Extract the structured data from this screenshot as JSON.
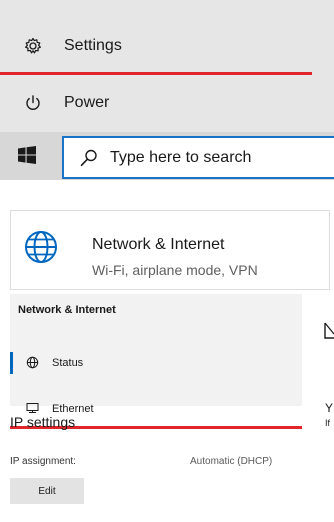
{
  "start_menu": {
    "settings_label": "Settings",
    "power_label": "Power"
  },
  "taskbar": {
    "search_placeholder": "Type here to search"
  },
  "settings_tile": {
    "title": "Network & Internet",
    "subtitle": "Wi-Fi, airplane mode, VPN"
  },
  "network_panel": {
    "title": "Network & Internet",
    "nav_items": [
      {
        "label": "Status",
        "icon": "home-icon",
        "selected": true
      },
      {
        "label": "Ethernet",
        "icon": "ethernet-icon",
        "selected": false
      }
    ],
    "truncated_right": [
      "Y",
      "If"
    ]
  },
  "ip_settings": {
    "heading": "IP settings",
    "assignment_label": "IP assignment:",
    "assignment_value": "Automatic (DHCP)",
    "edit_label": "Edit"
  },
  "colors": {
    "highlight_red": "#e0262b",
    "accent_blue": "#0067c0",
    "search_border": "#1a73c8"
  }
}
